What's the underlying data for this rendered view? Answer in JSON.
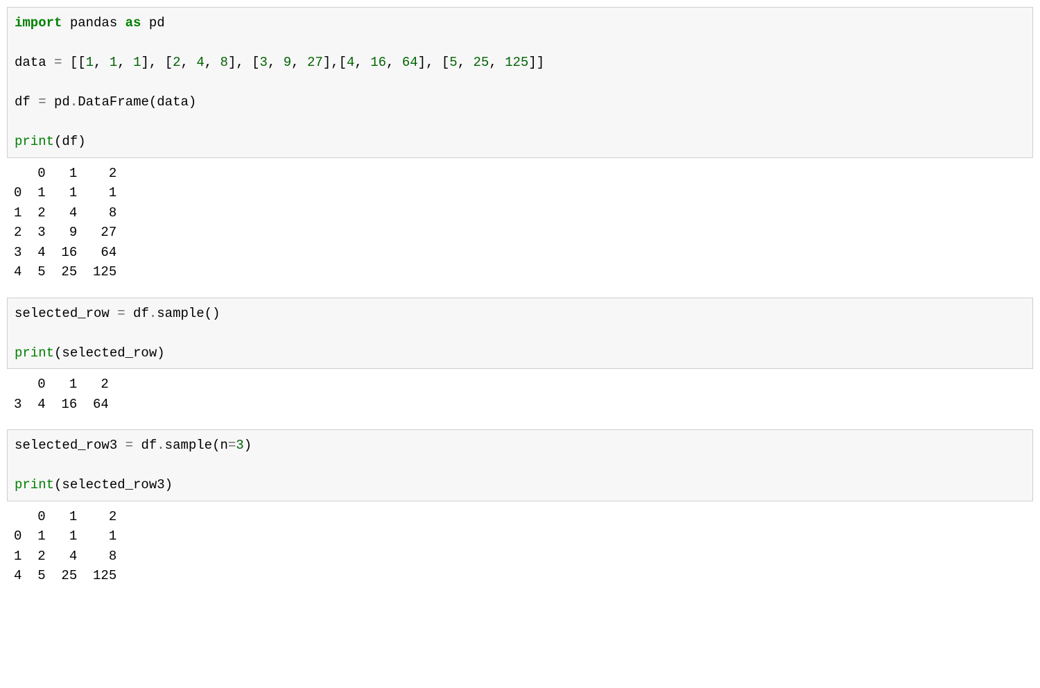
{
  "cells": [
    {
      "type": "input",
      "tokens": [
        {
          "t": "import",
          "c": "kw"
        },
        {
          "t": " pandas ",
          "c": "name"
        },
        {
          "t": "as",
          "c": "kw"
        },
        {
          "t": " pd\n\n",
          "c": "name"
        },
        {
          "t": "data ",
          "c": "name"
        },
        {
          "t": "=",
          "c": "op"
        },
        {
          "t": " [[",
          "c": "name"
        },
        {
          "t": "1",
          "c": "num"
        },
        {
          "t": ", ",
          "c": "name"
        },
        {
          "t": "1",
          "c": "num"
        },
        {
          "t": ", ",
          "c": "name"
        },
        {
          "t": "1",
          "c": "num"
        },
        {
          "t": "], [",
          "c": "name"
        },
        {
          "t": "2",
          "c": "num"
        },
        {
          "t": ", ",
          "c": "name"
        },
        {
          "t": "4",
          "c": "num"
        },
        {
          "t": ", ",
          "c": "name"
        },
        {
          "t": "8",
          "c": "num"
        },
        {
          "t": "], [",
          "c": "name"
        },
        {
          "t": "3",
          "c": "num"
        },
        {
          "t": ", ",
          "c": "name"
        },
        {
          "t": "9",
          "c": "num"
        },
        {
          "t": ", ",
          "c": "name"
        },
        {
          "t": "27",
          "c": "num"
        },
        {
          "t": "],[",
          "c": "name"
        },
        {
          "t": "4",
          "c": "num"
        },
        {
          "t": ", ",
          "c": "name"
        },
        {
          "t": "16",
          "c": "num"
        },
        {
          "t": ", ",
          "c": "name"
        },
        {
          "t": "64",
          "c": "num"
        },
        {
          "t": "], [",
          "c": "name"
        },
        {
          "t": "5",
          "c": "num"
        },
        {
          "t": ", ",
          "c": "name"
        },
        {
          "t": "25",
          "c": "num"
        },
        {
          "t": ", ",
          "c": "name"
        },
        {
          "t": "125",
          "c": "num"
        },
        {
          "t": "]]\n\n",
          "c": "name"
        },
        {
          "t": "df ",
          "c": "name"
        },
        {
          "t": "=",
          "c": "op"
        },
        {
          "t": " pd",
          "c": "name"
        },
        {
          "t": ".",
          "c": "op"
        },
        {
          "t": "DataFrame(data)\n\n",
          "c": "name"
        },
        {
          "t": "print",
          "c": "builtin"
        },
        {
          "t": "(df)",
          "c": "name"
        }
      ]
    },
    {
      "type": "output",
      "text": "   0   1    2\n0  1   1    1\n1  2   4    8\n2  3   9   27\n3  4  16   64\n4  5  25  125"
    },
    {
      "type": "input",
      "tokens": [
        {
          "t": "selected_row ",
          "c": "name"
        },
        {
          "t": "=",
          "c": "op"
        },
        {
          "t": " df",
          "c": "name"
        },
        {
          "t": ".",
          "c": "op"
        },
        {
          "t": "sample()\n\n",
          "c": "name"
        },
        {
          "t": "print",
          "c": "builtin"
        },
        {
          "t": "(selected_row)",
          "c": "name"
        }
      ]
    },
    {
      "type": "output",
      "text": "   0   1   2\n3  4  16  64"
    },
    {
      "type": "input",
      "tokens": [
        {
          "t": "selected_row3 ",
          "c": "name"
        },
        {
          "t": "=",
          "c": "op"
        },
        {
          "t": " df",
          "c": "name"
        },
        {
          "t": ".",
          "c": "op"
        },
        {
          "t": "sample(n",
          "c": "name"
        },
        {
          "t": "=",
          "c": "op"
        },
        {
          "t": "3",
          "c": "num"
        },
        {
          "t": ")\n\n",
          "c": "name"
        },
        {
          "t": "print",
          "c": "builtin"
        },
        {
          "t": "(selected_row3)",
          "c": "name"
        }
      ]
    },
    {
      "type": "output",
      "text": "   0   1    2\n0  1   1    1\n1  2   4    8\n4  5  25  125"
    }
  ]
}
